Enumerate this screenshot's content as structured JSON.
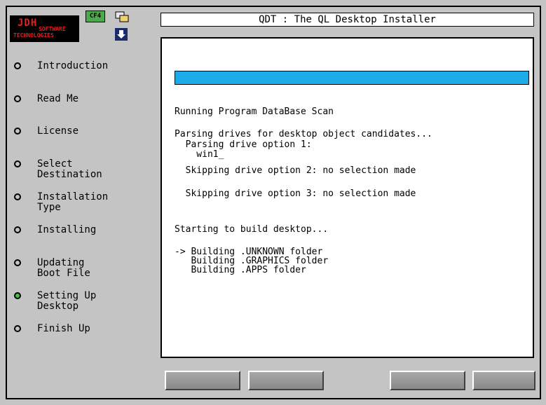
{
  "logo": {
    "line1": "JDH",
    "line2": "SOFTWARE",
    "line3": "TECHNOLOGIES"
  },
  "badge": {
    "text": "CF4"
  },
  "window_title": "QDT :  The QL Desktop Installer",
  "steps": [
    {
      "label": "Introduction",
      "active": false
    },
    {
      "label": "Read Me",
      "active": false
    },
    {
      "label": "License",
      "active": false
    },
    {
      "label": "Select\nDestination",
      "active": false
    },
    {
      "label": "Installation\nType",
      "active": false
    },
    {
      "label": "Installing",
      "active": false
    },
    {
      "label": "Updating\nBoot File",
      "active": false
    },
    {
      "label": "Setting Up\nDesktop",
      "active": true
    },
    {
      "label": "Finish Up",
      "active": false
    }
  ],
  "progress": {
    "fraction": 1.0,
    "color": "#1aabe8"
  },
  "log": {
    "l1": "Running Program DataBase Scan",
    "l2": "Parsing drives for desktop object candidates...",
    "l3": "  Parsing drive option 1:",
    "l4": "    win1_",
    "l5": "  Skipping drive option 2: no selection made",
    "l6": "  Skipping drive option 3: no selection made",
    "l7": "Starting to build desktop...",
    "l8": "-> Building .UNKNOWN folder",
    "l9": "   Building .GRAPHICS folder",
    "l10": "   Building .APPS folder"
  },
  "colors": {
    "background": "#c4c4c4",
    "active_step": "#3cc83c",
    "logo_text": "#e02020"
  }
}
